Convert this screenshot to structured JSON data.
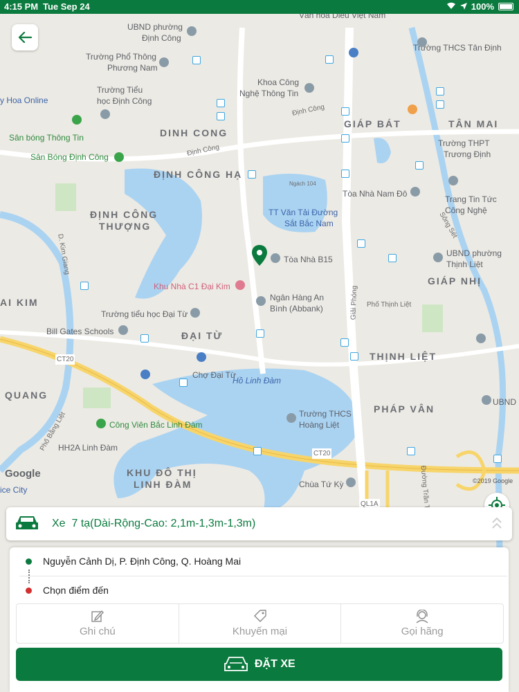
{
  "status_bar": {
    "time": "4:15 PM",
    "date": "Tue Sep 24",
    "battery": "100%"
  },
  "map": {
    "districts": [
      "DINH CONG",
      "ĐỊNH CÔNG HẠ",
      "ĐỊNH CÔNG",
      "THƯỢNG",
      "ĐẠI TỪ",
      "GIÁP BÁT",
      "TÂN MAI",
      "GIÁP NHỊ",
      "THỊNH LIỆT",
      "PHÁP VÂN",
      "AI KIM",
      "QUANG",
      "KHU ĐÔ THỊ",
      "LINH ĐÀM"
    ],
    "places": [
      "UBND phường",
      "Định Công",
      "Trường Phổ Thông",
      "Phương Nam",
      "Khoa Công",
      "Nghệ Thông Tin",
      "Trường Tiểu",
      "học Định Công",
      "y Hoa Online",
      "Sân bóng Thông Tin",
      "Sân Bóng Định Công",
      "TT Văn Tải Đường",
      "Sắt Bắc Nam",
      "Tòa Nhà B15",
      "Khu Nhà C1 Đại Kim",
      "Ngân Hàng An",
      "Bình (Abbank)",
      "Trường tiểu học Đại Từ",
      "Bill Gates Schools",
      "Chợ Đại Từ",
      "Hồ Linh Đàm",
      "Trường THCS",
      "Hoàng Liệt",
      "Công Viên Bắc Linh Đàm",
      "HH2A Linh Đàm",
      "Chùa Tứ Kỳ",
      "ice City",
      "Tòa Nhà Nam Đô",
      "Trang Tin Tức",
      "Công Nghệ",
      "UBND phường",
      "Thịnh Liệt",
      "Trường THCS Tân Định",
      "Trường THPT",
      "Trương Định",
      "Văn hóa Diễu Việt Nam",
      "UBND",
      "Phố Thịnh Liệt"
    ],
    "roads": [
      "Định Công",
      "Định Công",
      "Ngách 104",
      "Giải Phóng",
      "CT20",
      "CT20",
      "QL1A",
      "D. Kim Giang",
      "Phố Bằng Liệt",
      "Sông Sét",
      "Đường Trần Thủ Độ"
    ],
    "google_label": "Google",
    "copyright": "©2019 Google"
  },
  "vehicle": {
    "type_label": "Xe",
    "description": "7 tạ(Dài-Rộng-Cao: 2,1m-1,3m-1,3m)"
  },
  "route": {
    "pickup": "Nguyễn Cảnh Dị, P. Định Công, Q. Hoàng Mai",
    "destination": "Chọn điểm đến"
  },
  "actions": {
    "note": "Ghi chú",
    "promo": "Khuyến mại",
    "call": "Gọi hãng"
  },
  "book_label": "ĐẶT XE",
  "colors": {
    "brand": "#0b7a3e",
    "pickup_dot": "#0b7a3e",
    "dest_dot": "#d32f2f"
  }
}
